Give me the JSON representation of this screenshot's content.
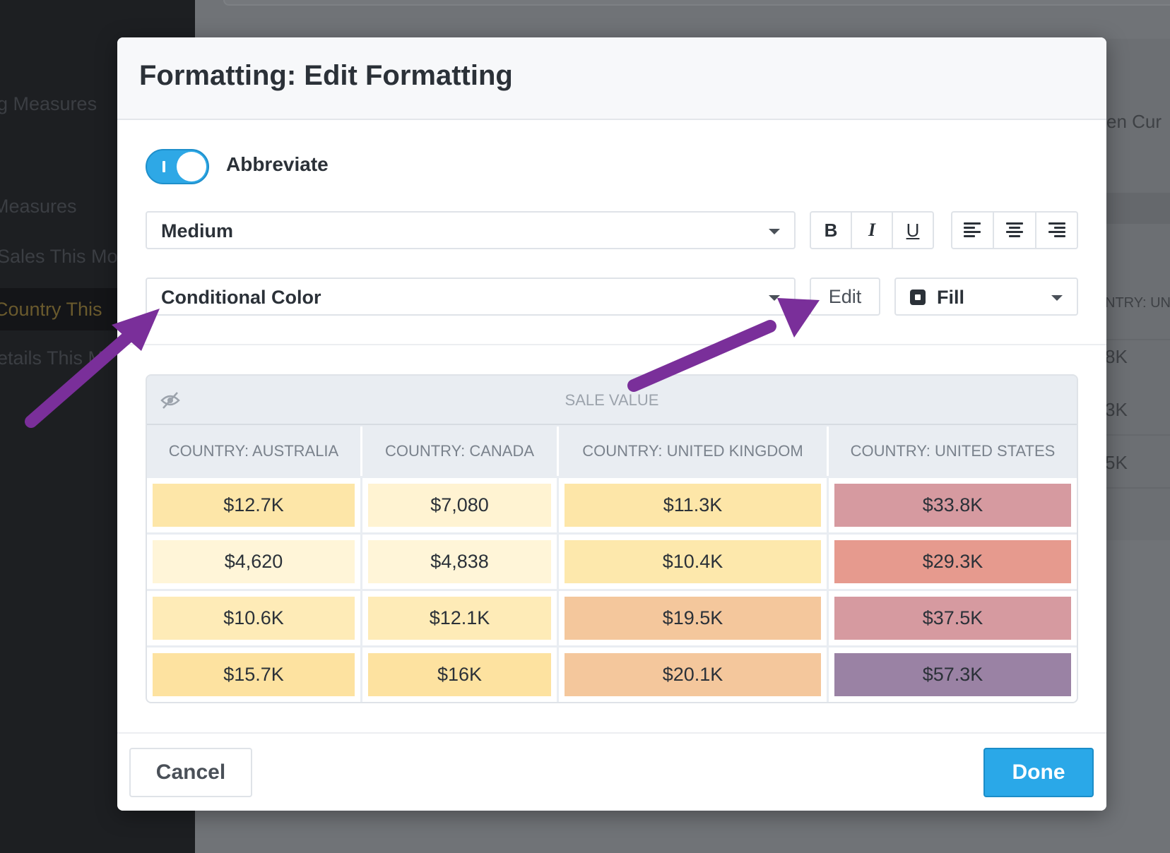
{
  "background": {
    "sidebar_items": [
      "g Measures",
      "Measures",
      "Sales This Mo",
      "Country This",
      "etails This M"
    ],
    "right_texts": [
      "en  Cur",
      "NTRY: UN",
      "8K",
      "3K",
      "5K"
    ]
  },
  "modal": {
    "title": "Formatting: Edit Formatting",
    "abbreviate": {
      "label": "Abbreviate",
      "on": true
    },
    "size_select": {
      "value": "Medium"
    },
    "style_buttons": {
      "bold": "B",
      "italic": "I",
      "underline": "U"
    },
    "align_buttons": [
      "align-left",
      "align-center",
      "align-right"
    ],
    "color_select": {
      "value": "Conditional Color"
    },
    "edit_button": "Edit",
    "fill_select": {
      "value": "Fill"
    },
    "preview": {
      "measure_header": "SALE VALUE",
      "columns": [
        "COUNTRY: AUSTRALIA",
        "COUNTRY: CANADA",
        "COUNTRY: UNITED KINGDOM",
        "COUNTRY: UNITED STATES"
      ],
      "rows": [
        [
          {
            "v": "$12.7K",
            "c": "#fde6a8"
          },
          {
            "v": "$7,080",
            "c": "#fff3d2"
          },
          {
            "v": "$11.3K",
            "c": "#fde6a8"
          },
          {
            "v": "$33.8K",
            "c": "#d69aa0"
          }
        ],
        [
          {
            "v": "$4,620",
            "c": "#fff5d8"
          },
          {
            "v": "$4,838",
            "c": "#fff5d8"
          },
          {
            "v": "$10.4K",
            "c": "#fde8ac"
          },
          {
            "v": "$29.3K",
            "c": "#e69a8e"
          }
        ],
        [
          {
            "v": "$10.6K",
            "c": "#feebb7"
          },
          {
            "v": "$12.1K",
            "c": "#feebb7"
          },
          {
            "v": "$19.5K",
            "c": "#f4c79c"
          },
          {
            "v": "$37.5K",
            "c": "#d69aa0"
          }
        ],
        [
          {
            "v": "$15.7K",
            "c": "#fde2a0"
          },
          {
            "v": "$16K",
            "c": "#fde2a0"
          },
          {
            "v": "$20.1K",
            "c": "#f4c79c"
          },
          {
            "v": "$57.3K",
            "c": "#9a82a4"
          }
        ]
      ]
    },
    "cancel_button": "Cancel",
    "done_button": "Done"
  },
  "colors": {
    "accent": "#2aa8e8",
    "annotation_arrow": "#7a2f9a"
  }
}
